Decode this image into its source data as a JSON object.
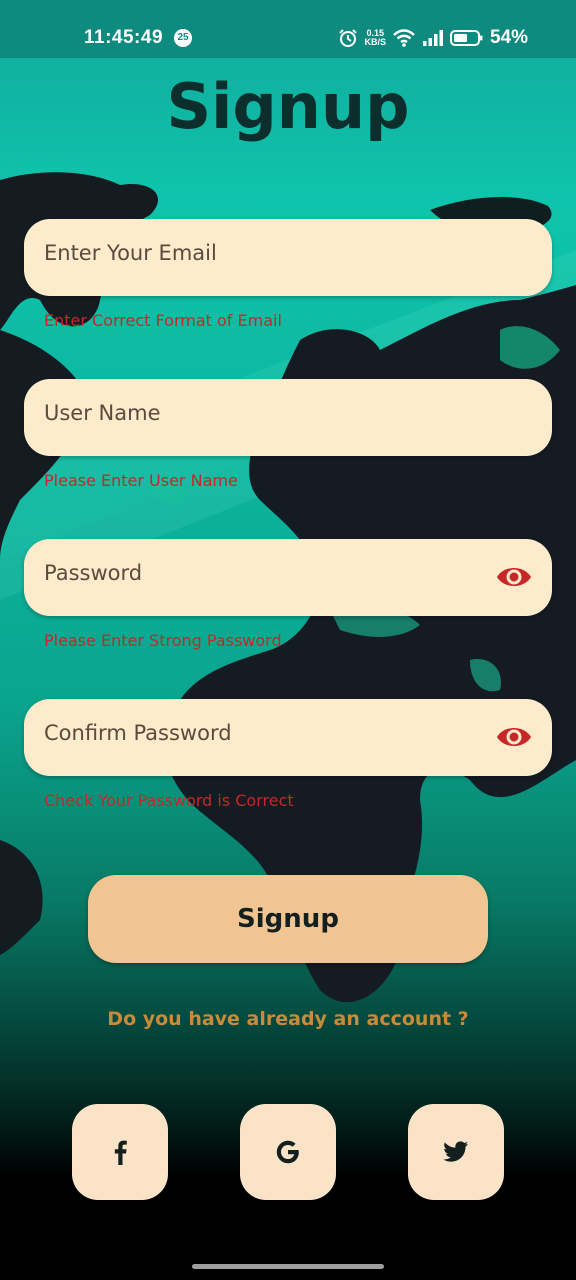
{
  "status_bar": {
    "time": "11:45:49",
    "notification_count": "25",
    "net_speed_value": "0.15",
    "net_speed_unit": "KB/S",
    "battery": "54%"
  },
  "page_title": "Signup",
  "fields": [
    {
      "placeholder": "Enter Your Email",
      "error": "Enter Correct Format of Email",
      "has_visibility_toggle": false
    },
    {
      "placeholder": "User Name",
      "error": "Please Enter User Name",
      "has_visibility_toggle": false
    },
    {
      "placeholder": "Password",
      "error": "Please Enter Strong Password",
      "has_visibility_toggle": true,
      "toggle_icon": "eye-icon"
    },
    {
      "placeholder": "Confirm Password",
      "error": "Check Your Password is Correct",
      "has_visibility_toggle": true,
      "toggle_icon": "eye-icon"
    }
  ],
  "signup_button": "Signup",
  "login_prompt": "Do you have already an account ?",
  "social_buttons": [
    {
      "name": "facebook",
      "icon": "facebook-icon"
    },
    {
      "name": "google",
      "icon": "google-icon"
    },
    {
      "name": "twitter",
      "icon": "twitter-icon"
    }
  ],
  "colors": {
    "field_bg": "#feebcc",
    "error_text": "#c62828",
    "button_bg": "#f0c592",
    "title_text": "#0c2e2c",
    "accent_teal": "#0fc4ac",
    "eye_icon": "#c62828",
    "link_text": "#c98a3a"
  }
}
